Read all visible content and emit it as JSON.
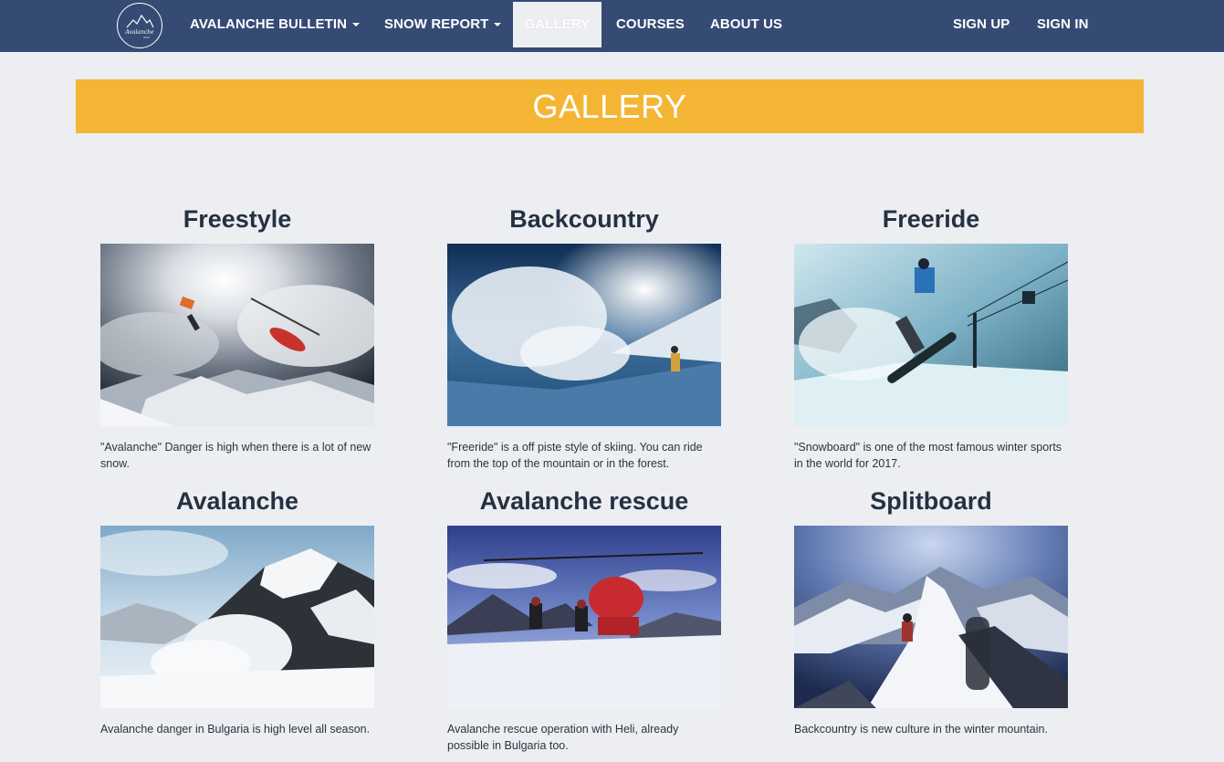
{
  "nav": {
    "logo_text": "Avalanche",
    "items": [
      {
        "label": "AVALANCHE BULLETIN",
        "dropdown": true
      },
      {
        "label": "SNOW REPORT",
        "dropdown": true
      },
      {
        "label": "GALLERY",
        "active": true
      },
      {
        "label": "COURSES"
      },
      {
        "label": "ABOUT US"
      }
    ],
    "auth": [
      {
        "label": "SIGN UP"
      },
      {
        "label": "SIGN IN"
      }
    ]
  },
  "banner": {
    "title": "GALLERY"
  },
  "gallery": [
    {
      "title": "Freestyle",
      "caption": "\"Avalanche\" Danger is high when there is a lot of new snow."
    },
    {
      "title": "Backcountry",
      "caption": "\"Freeride\" is a off piste style of skiing. You can ride from the top of the mountain or in the forest."
    },
    {
      "title": "Freeride",
      "caption": "\"Snowboard\" is one of the most famous winter sports in the world for 2017."
    },
    {
      "title": "Avalanche",
      "caption": "Avalanche danger in Bulgaria is high level all season."
    },
    {
      "title": "Avalanche rescue",
      "caption": "Avalanche rescue operation with Heli, already possible in Bulgaria too."
    },
    {
      "title": "Splitboard",
      "caption": "Backcountry is new culture in the winter mountain."
    }
  ],
  "colors": {
    "navbar": "#354b74",
    "banner": "#f5b534",
    "page_background": "#eceef2"
  }
}
